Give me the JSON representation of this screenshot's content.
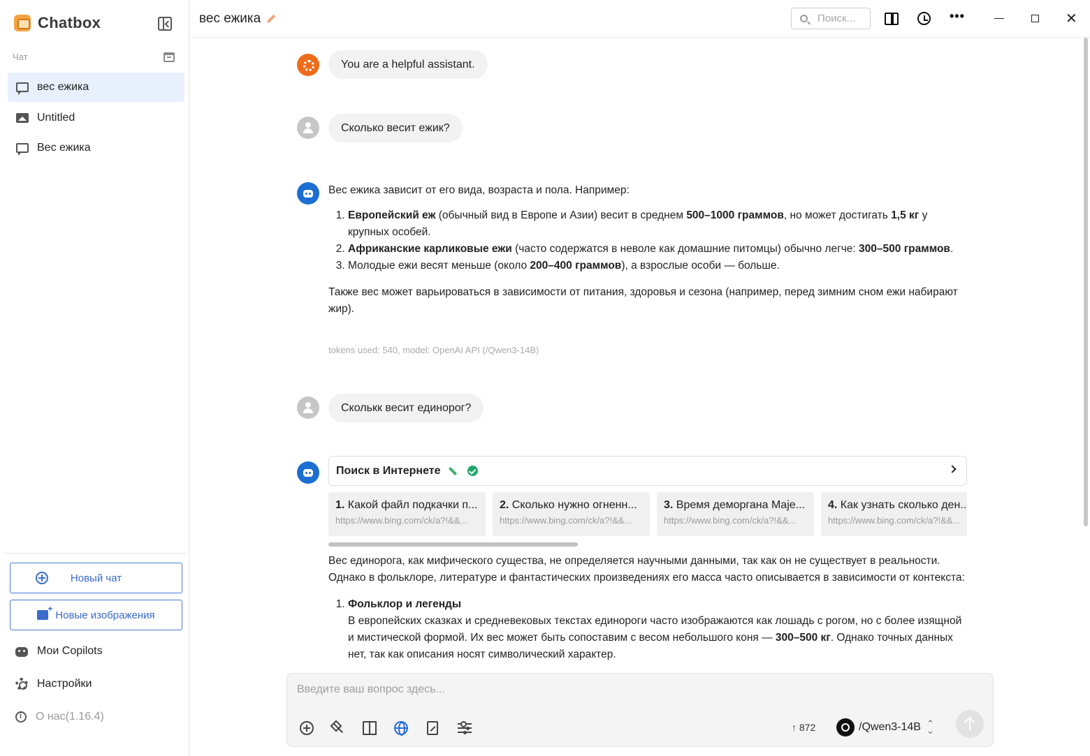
{
  "app": {
    "name": "Chatbox",
    "version_label": "О нас(1.16.4)"
  },
  "sidebar": {
    "section_label": "Чат",
    "chats": [
      {
        "label": "вес ежика",
        "icon": "chat-bubble-icon",
        "active": true
      },
      {
        "label": "Untitled",
        "icon": "image-icon",
        "active": false
      },
      {
        "label": "Вес ежика",
        "icon": "chat-bubble-icon",
        "active": false
      }
    ],
    "new_chat_label": "Новый чат",
    "new_images_label": "Новые изображения",
    "copilots_label": "Мои Copilots",
    "settings_label": "Настройки"
  },
  "header": {
    "title": "вес ежика",
    "search_placeholder": "Поиск..."
  },
  "messages": {
    "system": "You are a helpful assistant.",
    "user1": "Сколько весит ежик?",
    "bot1": {
      "intro": "Вес ежика зависит от его вида, возраста и пола. Например:",
      "items": [
        {
          "b1": "Европейский еж",
          "t1": " (обычный вид в Европе и Азии) весит в среднем ",
          "b2": "500–1000 граммов",
          "t2": ", но может достигать ",
          "b3": "1,5 кг",
          "t3": " у крупных особей."
        },
        {
          "b1": "Африканские карликовые ежи",
          "t1": " (часто содержатся в неволе как домашние питомцы) обычно легче: ",
          "b2": "300–500 граммов",
          "t2": "."
        },
        {
          "t0": "Молодые ежи весят меньше (около ",
          "b1": "200–400 граммов",
          "t1": "), а взрослые особи — больше."
        }
      ],
      "outro": "Также вес может варьироваться в зависимости от питания, здоровья и сезона (например, перед зимним сном ежи набирают жир).",
      "meta": "tokens used: 540, model: OpenAI API (/Qwen3-14B)"
    },
    "user2": "Сколькк весит единорог?",
    "bot2": {
      "web_search_label": "Поиск в Интернете",
      "results": [
        {
          "num": "1.",
          "title": "Какой файл подкачки п...",
          "url": "https://www.bing.com/ck/a?!&&..."
        },
        {
          "num": "2.",
          "title": "Сколько нужно огненн...",
          "url": "https://www.bing.com/ck/a?!&&..."
        },
        {
          "num": "3.",
          "title": "Время деморгана Maje...",
          "url": "https://www.bing.com/ck/a?!&&..."
        },
        {
          "num": "4.",
          "title": "Как узнать сколько ден...",
          "url": "https://www.bing.com/ck/a?!&&..."
        }
      ],
      "intro": "Вес единорога, как мифического существа, не определяется научными данными, так как он не существует в реальности. Однако в фольклоре, литературе и фантастических произведениях его масса часто описывается в зависимости от контекста:",
      "item1_title": "Фольклор и легенды",
      "item1_text_a": "В европейских сказках и средневековых текстах единороги часто изображаются как лошадь с рогом, но с более изящной и мистической формой. Их вес может быть сопоставим с весом небольшого коня — ",
      "item1_bold": "300–500 кг",
      "item1_text_b": ". Однако точных данных нет, так как описания носят символический характер."
    }
  },
  "composer": {
    "placeholder": "Введите ваш вопрос здесь...",
    "token_count": "↑ 872",
    "model": "/Qwen3-14B"
  }
}
